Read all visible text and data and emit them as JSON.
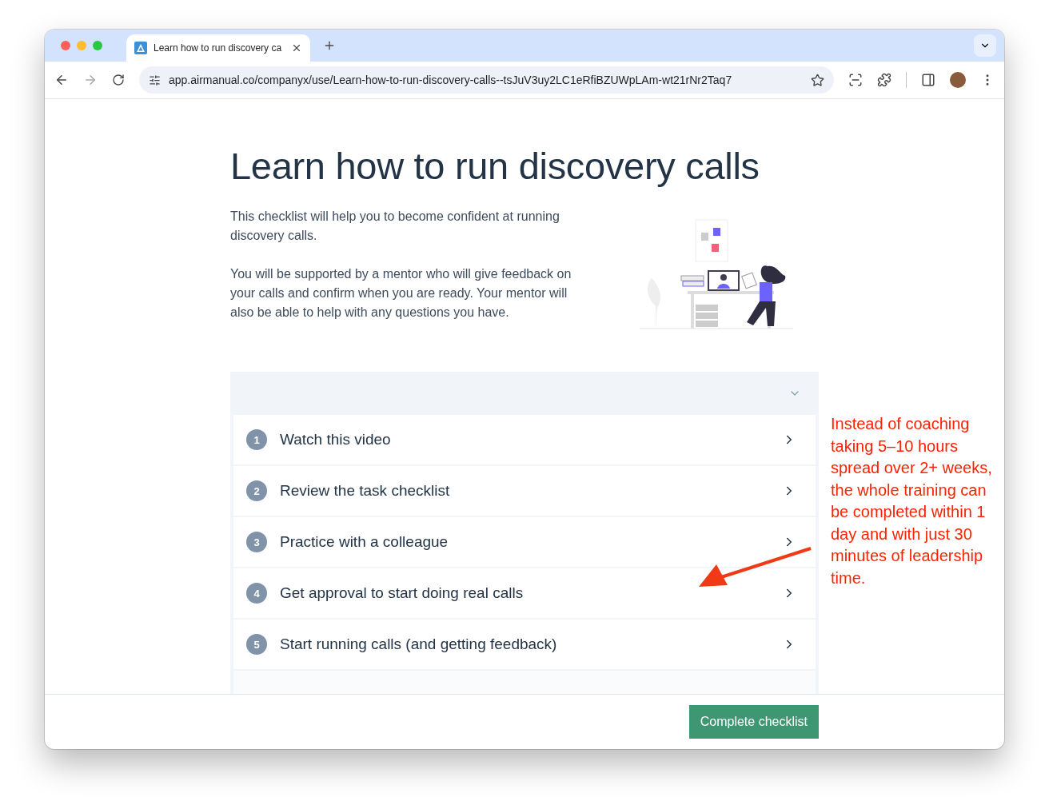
{
  "browser": {
    "tab_title": "Learn how to run discovery ca",
    "url": "app.airmanual.co/companyx/use/Learn-how-to-run-discovery-calls--tsJuV3uy2LC1eRfiBZUWpLAm-wt21rNr2Taq7"
  },
  "page": {
    "title": "Learn how to run discovery calls",
    "paragraphs": [
      "This checklist will help you to become confident at running discovery calls.",
      "You will be supported by a mentor who will give feedback on your calls and confirm when you are ready. Your mentor will also be able to help with any questions you have."
    ]
  },
  "checklist": {
    "expanded": true,
    "items": [
      {
        "number": "1",
        "label": "Watch this video"
      },
      {
        "number": "2",
        "label": "Review the task checklist"
      },
      {
        "number": "3",
        "label": "Practice with a colleague"
      },
      {
        "number": "4",
        "label": "Get approval to start doing real calls"
      },
      {
        "number": "5",
        "label": "Start running calls (and getting feedback)"
      }
    ]
  },
  "footer": {
    "button": "Complete checklist"
  },
  "annotation": {
    "text": "Instead of coaching taking 5–10 hours spread over 2+ weeks, the whole training can be completed within 1 day and with just 30 minutes of leadership time."
  }
}
